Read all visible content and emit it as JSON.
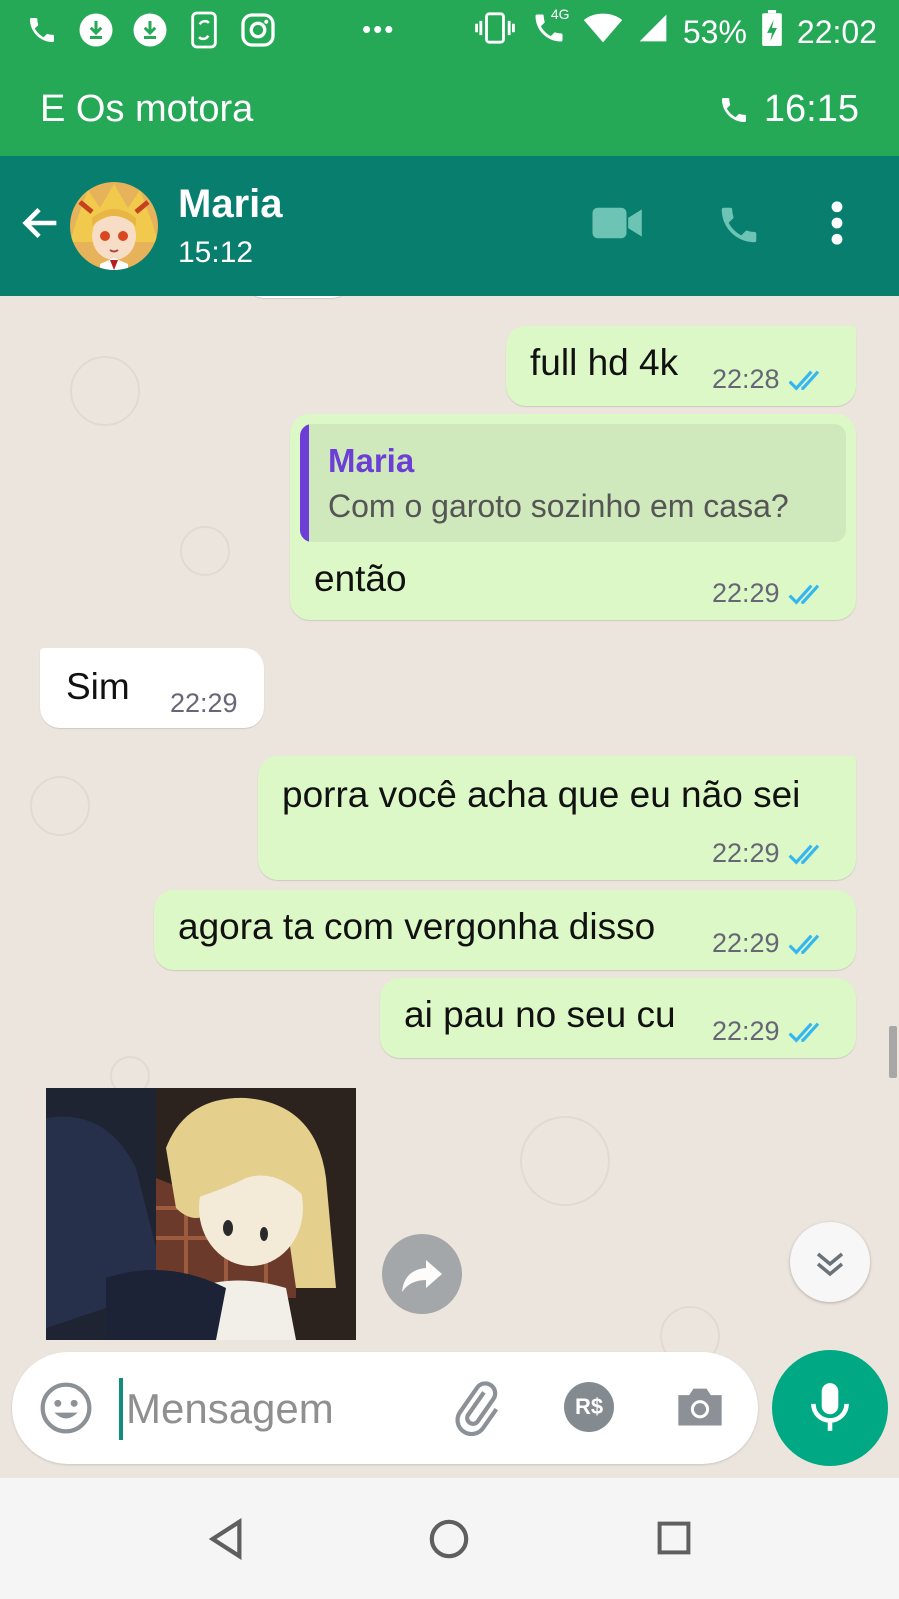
{
  "status_bar": {
    "battery": "53%",
    "time": "22:02",
    "network": "4G"
  },
  "call_banner": {
    "group_name": "E Os motora",
    "duration": "16:15"
  },
  "header": {
    "contact_name": "Maria",
    "subtitle": "15:12"
  },
  "messages": [
    {
      "id": "m1",
      "direction": "outgoing",
      "text": "full hd 4k",
      "time": "22:28"
    },
    {
      "id": "m2",
      "direction": "outgoing",
      "quoted_name": "Maria",
      "quoted_text": "Com o garoto sozinho em casa?",
      "text": "então",
      "time": "22:29"
    },
    {
      "id": "m3",
      "direction": "incoming",
      "text": "Sim",
      "time": "22:29"
    },
    {
      "id": "m4",
      "direction": "outgoing",
      "text": "porra você acha que eu não sei",
      "time": "22:29"
    },
    {
      "id": "m5",
      "direction": "outgoing",
      "text": "agora ta com vergonha disso",
      "time": "22:29"
    },
    {
      "id": "m6",
      "direction": "outgoing",
      "text": "ai pau no seu cu",
      "time": "22:29"
    }
  ],
  "input_bar": {
    "placeholder": "Mensagem",
    "payment_label": "R$"
  },
  "colors": {
    "status_green": "#25a957",
    "header_teal": "#087e6e",
    "outgoing_bubble": "#dcf8c6",
    "incoming_bubble": "#ffffff",
    "read_tick_blue": "#34b7f1",
    "quote_name_purple": "#6c3ed6",
    "mic_button": "#00a884"
  },
  "icons": {
    "status_left": [
      "phone-icon",
      "download-icon",
      "download-icon",
      "phone-sync-icon",
      "instagram-icon"
    ],
    "header": [
      "back-arrow-icon",
      "video-call-icon",
      "voice-call-icon",
      "more-vert-icon"
    ],
    "input": [
      "emoji-icon",
      "attach-icon",
      "payment-icon",
      "camera-icon",
      "mic-icon"
    ],
    "nav": [
      "nav-back-icon",
      "nav-home-icon",
      "nav-recents-icon"
    ]
  }
}
